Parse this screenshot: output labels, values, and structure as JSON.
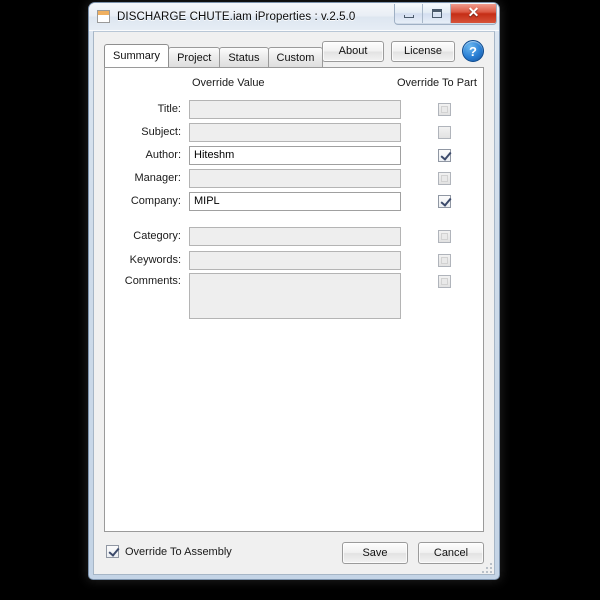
{
  "window": {
    "title": "DISCHARGE CHUTE.iam iProperties : v.2.5.0",
    "icon": "document-icon",
    "controls": {
      "minimize": "minimize-icon",
      "maximize": "maximize-icon",
      "close": "✕"
    }
  },
  "tabs": [
    {
      "label": "Summary",
      "active": true
    },
    {
      "label": "Project",
      "active": false
    },
    {
      "label": "Status",
      "active": false
    },
    {
      "label": "Custom",
      "active": false
    }
  ],
  "toolbar": {
    "about_label": "About",
    "license_label": "License",
    "help_label": "?"
  },
  "headers": {
    "override_value": "Override Value",
    "override_to_part": "Override To Part"
  },
  "fields": [
    {
      "label": "Title:",
      "value": "",
      "enabled": false,
      "checked": false
    },
    {
      "label": "Subject:",
      "value": "",
      "enabled": false,
      "checked": false
    },
    {
      "label": "Author:",
      "value": "Hiteshm",
      "enabled": true,
      "checked": true
    },
    {
      "label": "Manager:",
      "value": "",
      "enabled": false,
      "checked": false
    },
    {
      "label": "Company:",
      "value": "MIPL",
      "enabled": true,
      "checked": true
    },
    {
      "label": "Category:",
      "value": "",
      "enabled": false,
      "checked": false
    },
    {
      "label": "Keywords:",
      "value": "",
      "enabled": false,
      "checked": false
    },
    {
      "label": "Comments:",
      "value": "",
      "enabled": false,
      "checked": false
    }
  ],
  "footer": {
    "override_to_assembly_label": "Override To Assembly",
    "override_to_assembly_checked": true,
    "save_label": "Save",
    "cancel_label": "Cancel"
  },
  "colors": {
    "close_button": "#c52d16",
    "help_button": "#2a7fd4",
    "window_frame": "#cfdcea",
    "page_background": "#000000"
  }
}
